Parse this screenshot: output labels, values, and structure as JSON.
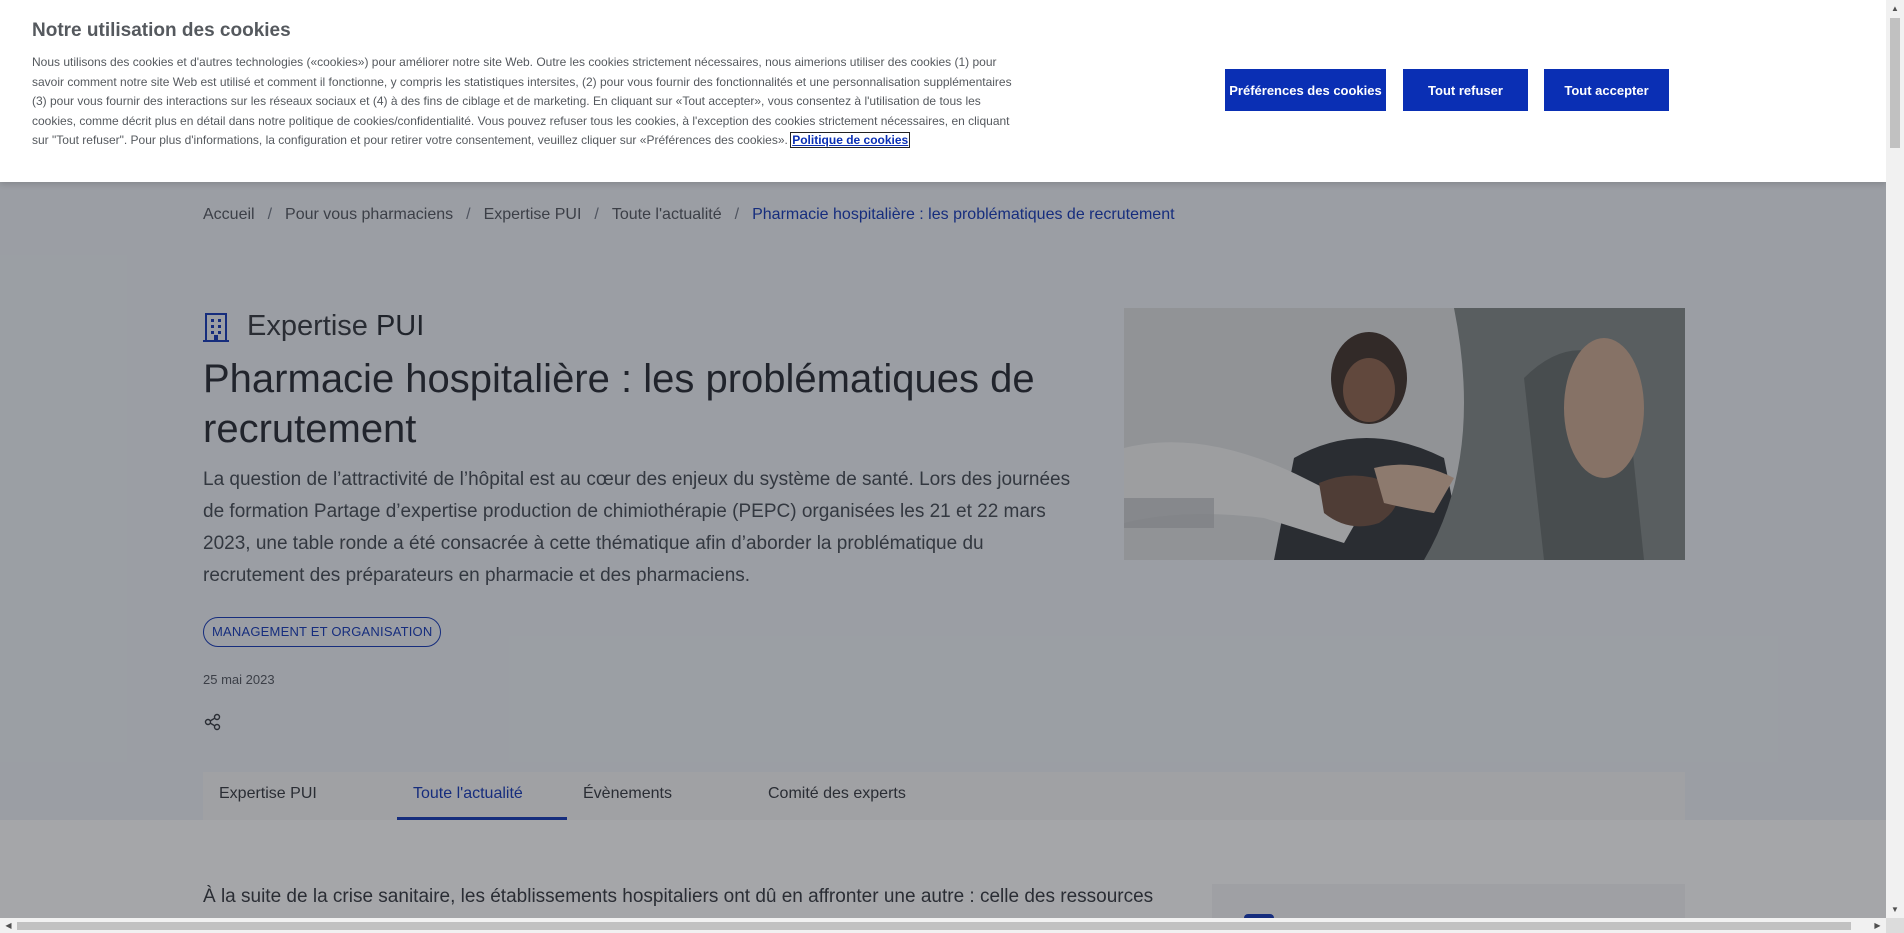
{
  "breadcrumb": {
    "items": [
      "Accueil",
      "Pour vous pharmaciens",
      "Expertise PUI",
      "Toute l'actualité"
    ],
    "current": "Pharmacie hospitalière : les problématiques de recrutement",
    "separator": "/"
  },
  "section": {
    "prefix": "Expertise",
    "bold": "PUI",
    "icon": "hospital-building-icon"
  },
  "article": {
    "title": "Pharmacie hospitalière : les problématiques de recrutement",
    "lead": "La question de l’attractivité de l’hôpital est au cœur des enjeux du système de santé. Lors des journées de formation Partage d’expertise production de chimiothérapie (PEPC) organisées les 21 et 22 mars 2023, une table ronde a été consacrée à cette thématique afin d’aborder la problématique du recrutement des préparateurs en pharmacie et des pharmaciens.",
    "tag": "MANAGEMENT ET ORGANISATION",
    "date": "25 mai 2023",
    "body_start": "À la suite de la crise sanitaire, les établissements hospitaliers ont dû en affronter une autre : celle des ressources"
  },
  "tabs": [
    {
      "label": "Expertise PUI",
      "active": false
    },
    {
      "label": "Toute l'actualité",
      "active": true
    },
    {
      "label": "Évènements",
      "active": false
    },
    {
      "label": "Comité des experts",
      "active": false
    }
  ],
  "cookie": {
    "title": "Notre utilisation des cookies",
    "text": "Nous utilisons des cookies et d'autres technologies («cookies») pour améliorer notre site Web. Outre les cookies strictement nécessaires, nous aimerions utiliser des cookies (1) pour savoir comment notre site Web est utilisé et comment il fonctionne, y compris les statistiques intersites, (2) pour vous fournir des fonctionnalités et une personnalisation supplémentaires (3) pour vous fournir des interactions sur les réseaux sociaux et (4) à des fins de ciblage et de marketing. En cliquant sur «Tout accepter», vous consentez à l'utilisation de tous les cookies, comme décrit plus en détail dans notre politique de cookies/confidentialité. Vous pouvez refuser tous les cookies, à l'exception des cookies strictement nécessaires, en cliquant sur \"Tout refuser\". Pour plus d'informations, la configuration et pour retirer votre consentement, veuillez cliquer sur «Préférences des cookies».",
    "policy_link": "Politique de cookies",
    "buttons": {
      "preferences": "Préférences des cookies",
      "refuse": "Tout refuser",
      "accept": "Tout accepter"
    }
  },
  "colors": {
    "brand_blue": "#0a2fb4",
    "overlay": "rgba(40,44,50,0.42)"
  }
}
